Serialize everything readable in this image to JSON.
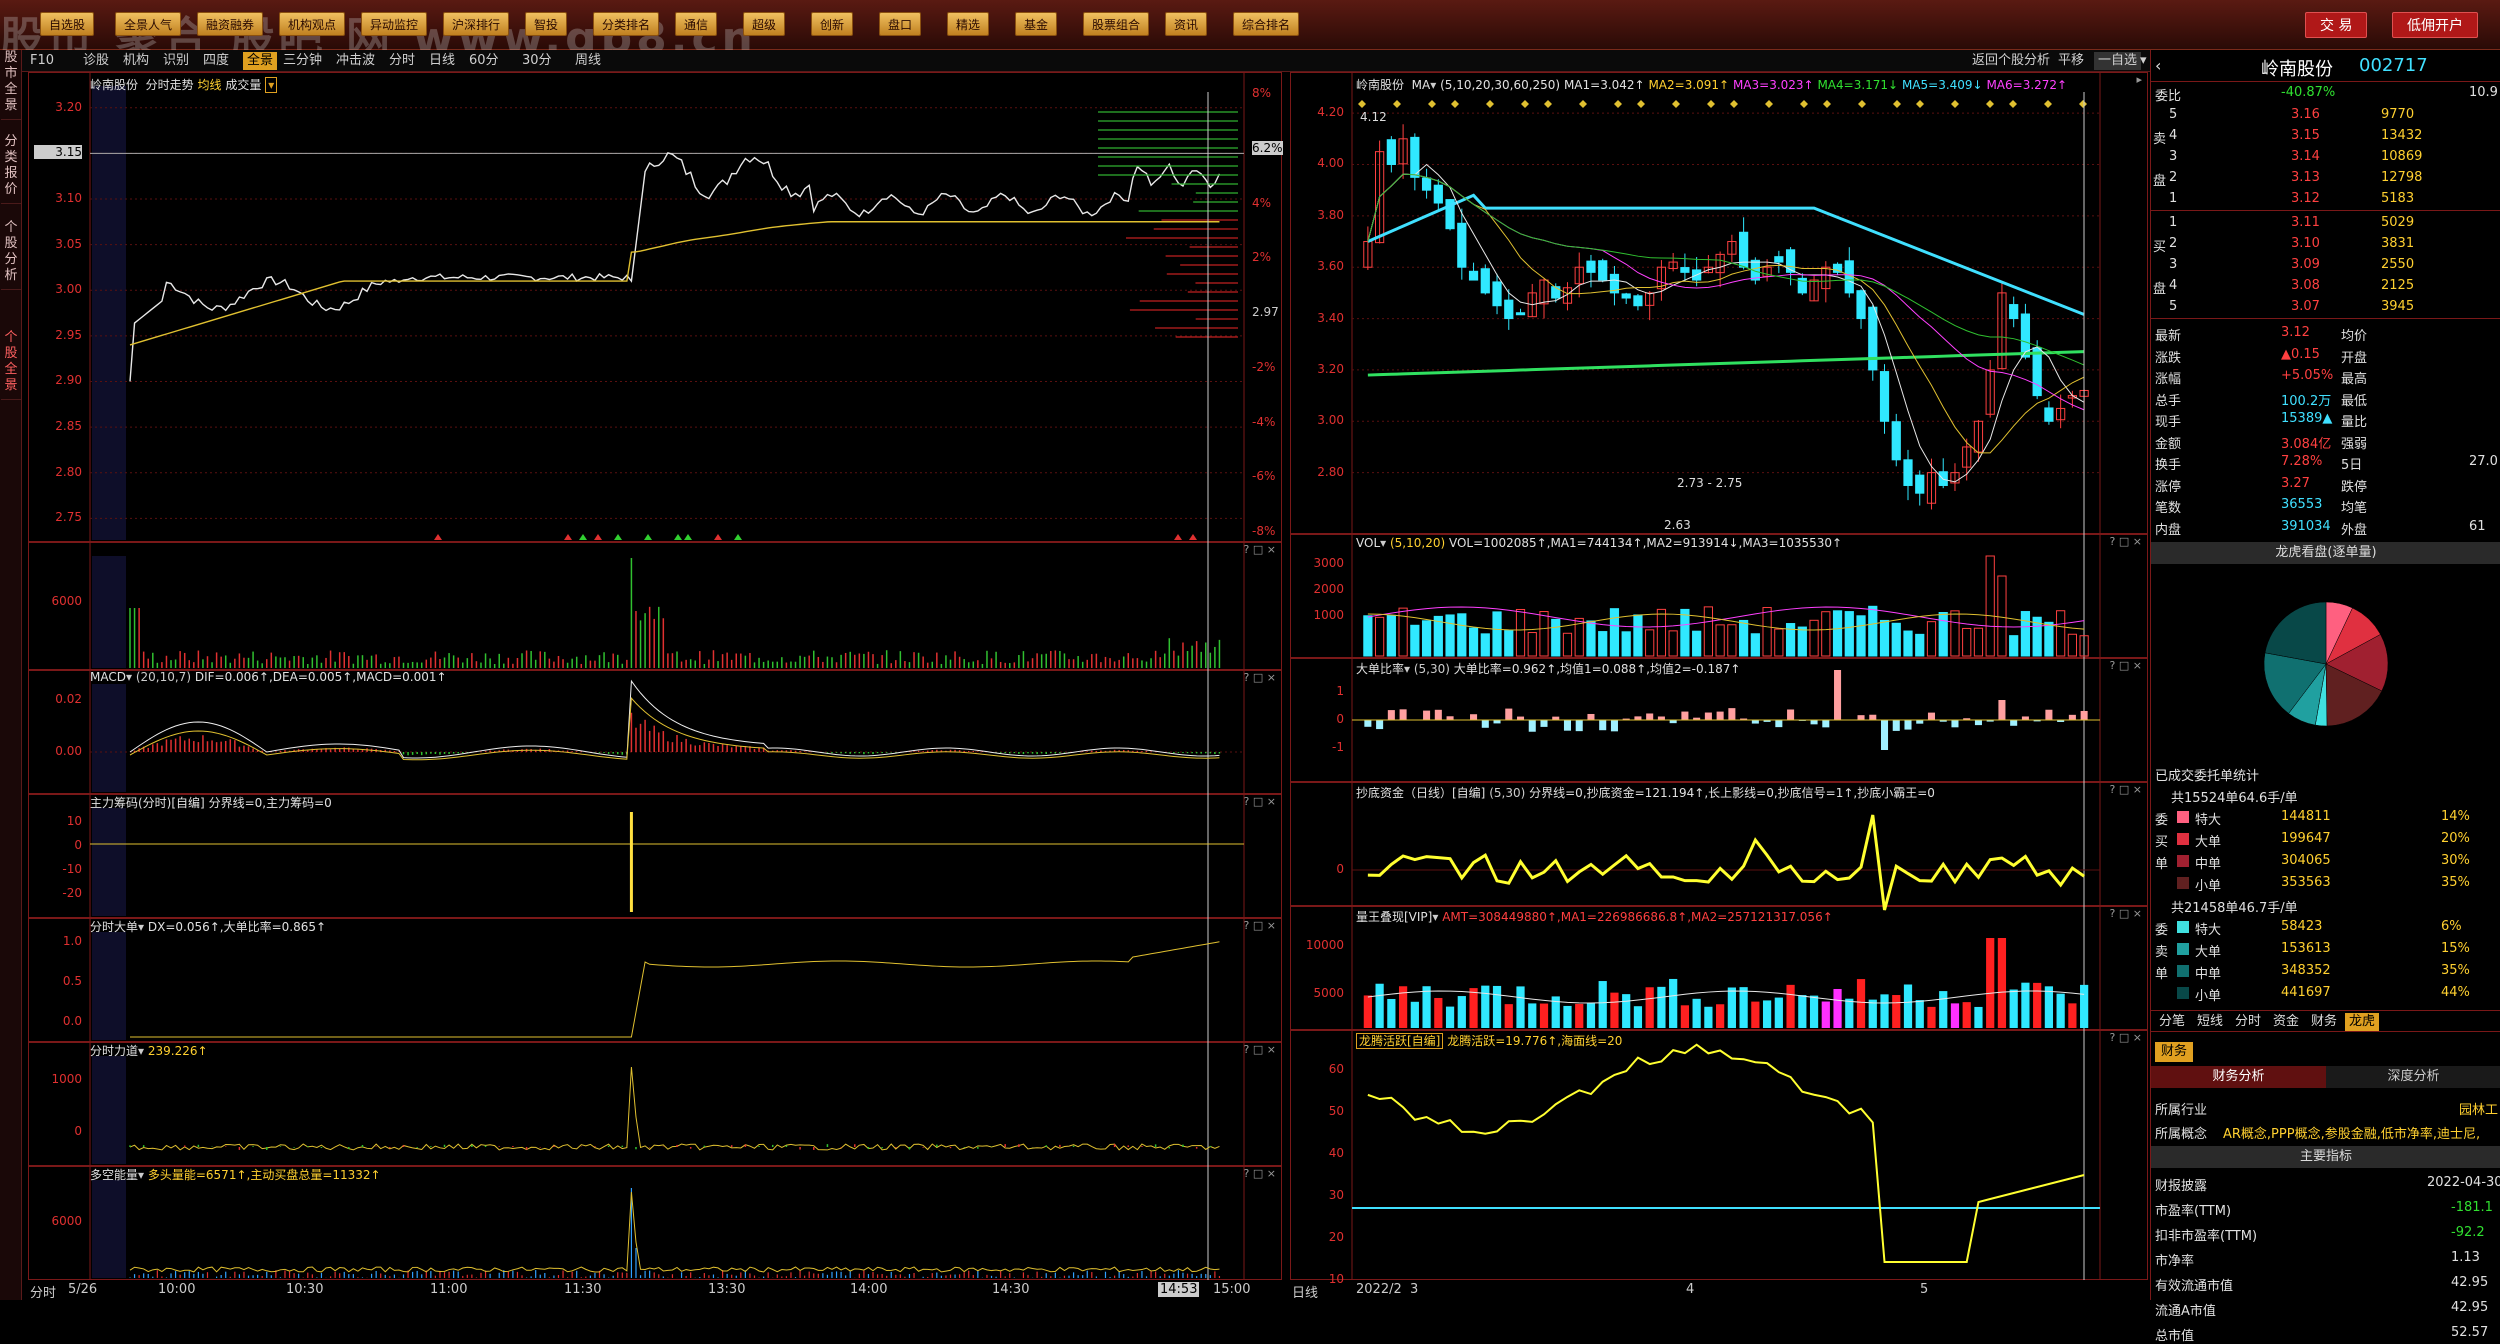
{
  "watermark": "股市 聚合 股吧 网 www.gp8.cn",
  "topbar": {
    "buttons": [
      "自选股",
      "全景人气",
      "融资融券",
      "机构观点",
      "异动监控",
      "沪深排行",
      "智投",
      "分类排名",
      "通信",
      "超级",
      "创新",
      "盘口",
      "精选",
      "基金",
      "股票组合",
      "资讯",
      "综合排名"
    ],
    "right_buttons": [
      "交 易",
      "低佣开户"
    ]
  },
  "sidebar": {
    "tabs": [
      "股市全景",
      "分类报价",
      "个股分析",
      "个股全景"
    ]
  },
  "toolbar": {
    "items": [
      "F10",
      "诊股",
      "机构",
      "识别",
      "四度",
      "全景",
      "三分钟",
      "冲击波",
      "分时",
      "日线",
      "60分",
      "30分",
      "周线"
    ],
    "active": "全景",
    "right_items": [
      "返回个股分析",
      "平移",
      "一自选"
    ]
  },
  "intraday": {
    "title": "岭南股份",
    "subtitle": "分时走势",
    "avg_label": "均线",
    "vol_label": "成交量",
    "price_ticks": [
      "3.20",
      "3.15",
      "3.10",
      "3.05",
      "3.00",
      "2.95",
      "2.90",
      "2.85",
      "2.80",
      "2.75"
    ],
    "pct_ticks": [
      "8%",
      "6.2%",
      "4%",
      "2%",
      "2.97",
      "-2%",
      "-4%",
      "-6%",
      "-8%"
    ],
    "vol_tick": "6000",
    "macd_title": "MACD",
    "macd_params": "(20,10,7)",
    "macd_vals": "DIF=0.006↑,DEA=0.005↑,MACD=0.001↑",
    "macd_ticks": [
      "0.02",
      "0.00"
    ],
    "zl_title": "主力筹码(分时)[自编]",
    "zl_vals": "分界线=0,主力筹码=0",
    "zl_ticks": [
      "10",
      "0",
      "-10",
      "-20"
    ],
    "dd_title": "分时大单",
    "dd_vals": "DX=0.056↑,大单比率=0.865↑",
    "dd_ticks": [
      "1.0",
      "0.5",
      "0.0"
    ],
    "ld_title": "分时力道",
    "ld_vals": "239.226↑",
    "ld_ticks": [
      "1000",
      "0"
    ],
    "dk_title": "多空能量",
    "dk_vals": "多头量能=6571↑,主动买盘总量=11332↑",
    "dk_ticks": [
      "6000"
    ],
    "time_labels": [
      "分时",
      "5/26",
      "10:00",
      "10:30",
      "11:00",
      "11:30",
      "13:30",
      "14:00",
      "14:30",
      "14:53",
      "15:00"
    ]
  },
  "kline": {
    "title": "岭南股份",
    "ma_label": "MA",
    "ma_params": "(5,10,20,30,60,250)",
    "ma_vals": [
      "MA1=3.042↑",
      "MA2=3.091↑",
      "MA3=3.023↑",
      "MA4=3.171↓",
      "MA5=3.409↓",
      "MA6=3.272↑"
    ],
    "price_ticks": [
      "4.20",
      "4.00",
      "3.80",
      "3.60",
      "3.40",
      "3.20",
      "3.00",
      "2.80"
    ],
    "marks": [
      "4.12",
      "2.73 - 2.75",
      "2.63"
    ],
    "vol_title": "VOL",
    "vol_params": "(5,10,20)",
    "vol_vals": "VOL=1002085↑,MA1=744134↑,MA2=913914↓,MA3=1035530↑",
    "vol_ticks": [
      "3000",
      "2000",
      "1000"
    ],
    "dd_title": "大单比率",
    "dd_params": "(5,30)",
    "dd_vals": "大单比率=0.962↑,均值1=0.088↑,均值2=-0.187↑",
    "dd_ticks": [
      "1",
      "0",
      "-1"
    ],
    "cd_title": "抄底资金（日线）[自编]",
    "cd_params": "(5,30)",
    "cd_vals": "分界线=0,抄底资金=121.194↑,长上影线=0,抄底信号=1↑,抄底小霸王=0",
    "cd_ticks": [
      "0"
    ],
    "lw_title": "量王叠现[VIP]",
    "lw_vals": "AMT=308449880↑,MA1=226986686.8↑,MA2=257121317.056↑",
    "lw_ticks": [
      "10000",
      "5000"
    ],
    "lt_title": "龙腾活跃[自编]",
    "lt_vals": "龙腾活跃=19.776↑,海面线=20",
    "lt_ticks": [
      "60",
      "50",
      "40",
      "30",
      "20",
      "10"
    ],
    "date_labels": [
      "日线",
      "2022/2",
      "3",
      "4",
      "5"
    ]
  },
  "quote": {
    "name": "岭南股份",
    "code": "002717",
    "weibi_label": "委比",
    "weibi": "-40.87%",
    "weicha": "10.9",
    "sell": [
      {
        "lvl": "5",
        "p": "3.16",
        "v": "9770"
      },
      {
        "lvl": "4",
        "p": "3.15",
        "v": "13432"
      },
      {
        "lvl": "3",
        "p": "3.14",
        "v": "10869"
      },
      {
        "lvl": "2",
        "p": "3.13",
        "v": "12798"
      },
      {
        "lvl": "1",
        "p": "3.12",
        "v": "5183"
      }
    ],
    "buy": [
      {
        "lvl": "1",
        "p": "3.11",
        "v": "5029"
      },
      {
        "lvl": "2",
        "p": "3.10",
        "v": "3831"
      },
      {
        "lvl": "3",
        "p": "3.09",
        "v": "2550"
      },
      {
        "lvl": "4",
        "p": "3.08",
        "v": "2125"
      },
      {
        "lvl": "5",
        "p": "3.07",
        "v": "3945"
      }
    ],
    "sell_side": [
      "卖",
      "盘"
    ],
    "buy_side": [
      "买",
      "盘"
    ],
    "stats": [
      {
        "l": "最新",
        "v": "3.12",
        "l2": "均价",
        "v2": ""
      },
      {
        "l": "涨跌",
        "v": "▲0.15",
        "l2": "开盘",
        "v2": ""
      },
      {
        "l": "涨幅",
        "v": "+5.05%",
        "l2": "最高",
        "v2": ""
      },
      {
        "l": "总手",
        "v": "100.2万",
        "l2": "最低",
        "v2": ""
      },
      {
        "l": "现手",
        "v": "15389▲",
        "l2": "量比",
        "v2": ""
      },
      {
        "l": "金额",
        "v": "3.084亿",
        "l2": "强弱",
        "v2": ""
      },
      {
        "l": "换手",
        "v": "7.28%",
        "l2": "5日",
        "v2": "27.0"
      },
      {
        "l": "涨停",
        "v": "3.27",
        "l2": "跌停",
        "v2": ""
      },
      {
        "l": "笔数",
        "v": "36553",
        "l2": "均笔",
        "v2": ""
      },
      {
        "l": "内盘",
        "v": "391034",
        "l2": "外盘",
        "v2": "61"
      }
    ],
    "pie_title": "龙虎看盘(逐单量)",
    "deal_title": "已成交委托单统计",
    "buy_total": "共15524单64.6手/单",
    "buy_rows": [
      {
        "s": "委",
        "n": "特大",
        "v": "144811",
        "p": "14%",
        "c": "#ff6080"
      },
      {
        "s": "买",
        "n": "大单",
        "v": "199647",
        "p": "20%",
        "c": "#e03040"
      },
      {
        "s": "单",
        "n": "中单",
        "v": "304065",
        "p": "30%",
        "c": "#a02030"
      },
      {
        "s": "",
        "n": "小单",
        "v": "353563",
        "p": "35%",
        "c": "#602020"
      }
    ],
    "sell_total": "共21458单46.7手/单",
    "sell_rows": [
      {
        "s": "委",
        "n": "特大",
        "v": "58423",
        "p": "6%",
        "c": "#40e0e0"
      },
      {
        "s": "卖",
        "n": "大单",
        "v": "153613",
        "p": "15%",
        "c": "#20a0a0"
      },
      {
        "s": "单",
        "n": "中单",
        "v": "348352",
        "p": "35%",
        "c": "#107070"
      },
      {
        "s": "",
        "n": "小单",
        "v": "441697",
        "p": "44%",
        "c": "#084848"
      }
    ],
    "tabs": [
      "分笔",
      "短线",
      "分时",
      "资金",
      "财务",
      "龙虎"
    ],
    "active_tab": "龙虎",
    "cw_tab": "财务",
    "sub_tabs": [
      "财务分析",
      "深度分析"
    ],
    "industry_label": "所属行业",
    "industry": "园林工",
    "concept_label": "所属概念",
    "concept": "AR概念,PPP概念,参股金融,低市净率,迪士尼,",
    "main_idx": "主要指标",
    "fin": [
      {
        "l": "财报披露",
        "v": "2022-04-30"
      },
      {
        "l": "市盈率(TTM)",
        "v": "-181.1"
      },
      {
        "l": "扣非市盈率(TTM)",
        "v": "-92.2"
      },
      {
        "l": "市净率",
        "v": "1.13"
      },
      {
        "l": "有效流通市值",
        "v": "42.95"
      },
      {
        "l": "流通A市值",
        "v": "42.95"
      },
      {
        "l": "总市值",
        "v": "52.57"
      }
    ]
  }
}
